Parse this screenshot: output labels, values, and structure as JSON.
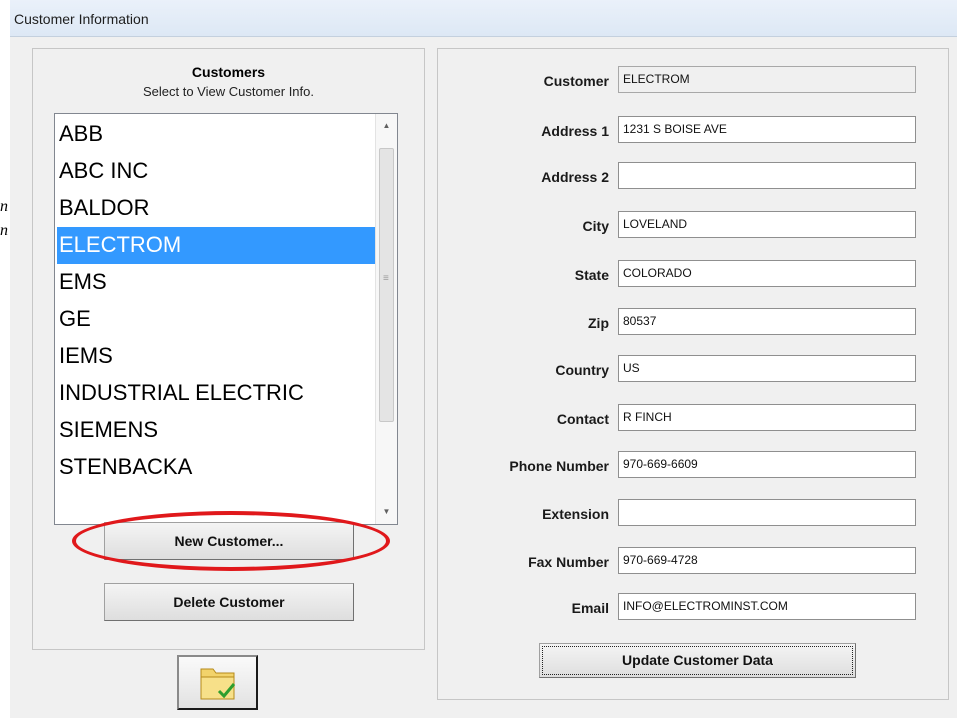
{
  "window": {
    "title": "Customer Information"
  },
  "stray_glyphs": [
    "n",
    "n"
  ],
  "customers_panel": {
    "heading": "Customers",
    "subheading": "Select to View Customer Info.",
    "items": [
      "ABB",
      "ABC INC",
      "BALDOR",
      "ELECTROM",
      "EMS",
      "GE",
      "IEMS",
      "INDUSTRIAL ELECTRIC",
      "SIEMENS",
      "STENBACKA"
    ],
    "selected": "ELECTROM",
    "new_button": "New Customer...",
    "delete_button": "Delete Customer"
  },
  "ok_button": {
    "icon": "folder-check-icon"
  },
  "fields": [
    {
      "key": "customer",
      "label": "Customer",
      "value": "ELECTROM",
      "readonly": true
    },
    {
      "key": "address1",
      "label": "Address 1",
      "value": "1231 S BOISE AVE"
    },
    {
      "key": "address2",
      "label": "Address 2",
      "value": ""
    },
    {
      "key": "city",
      "label": "City",
      "value": "LOVELAND"
    },
    {
      "key": "state",
      "label": "State",
      "value": "COLORADO"
    },
    {
      "key": "zip",
      "label": "Zip",
      "value": "80537"
    },
    {
      "key": "country",
      "label": "Country",
      "value": "US"
    },
    {
      "key": "contact",
      "label": "Contact",
      "value": "R FINCH"
    },
    {
      "key": "phone",
      "label": "Phone Number",
      "value": "970-669-6609"
    },
    {
      "key": "extension",
      "label": "Extension",
      "value": ""
    },
    {
      "key": "fax",
      "label": "Fax Number",
      "value": "970-669-4728"
    },
    {
      "key": "email",
      "label": "Email",
      "value": "INFO@ELECTROMINST.COM"
    }
  ],
  "update_button": "Update Customer Data",
  "colors": {
    "selection": "#3399ff",
    "annotation_ring": "#e0181b"
  }
}
